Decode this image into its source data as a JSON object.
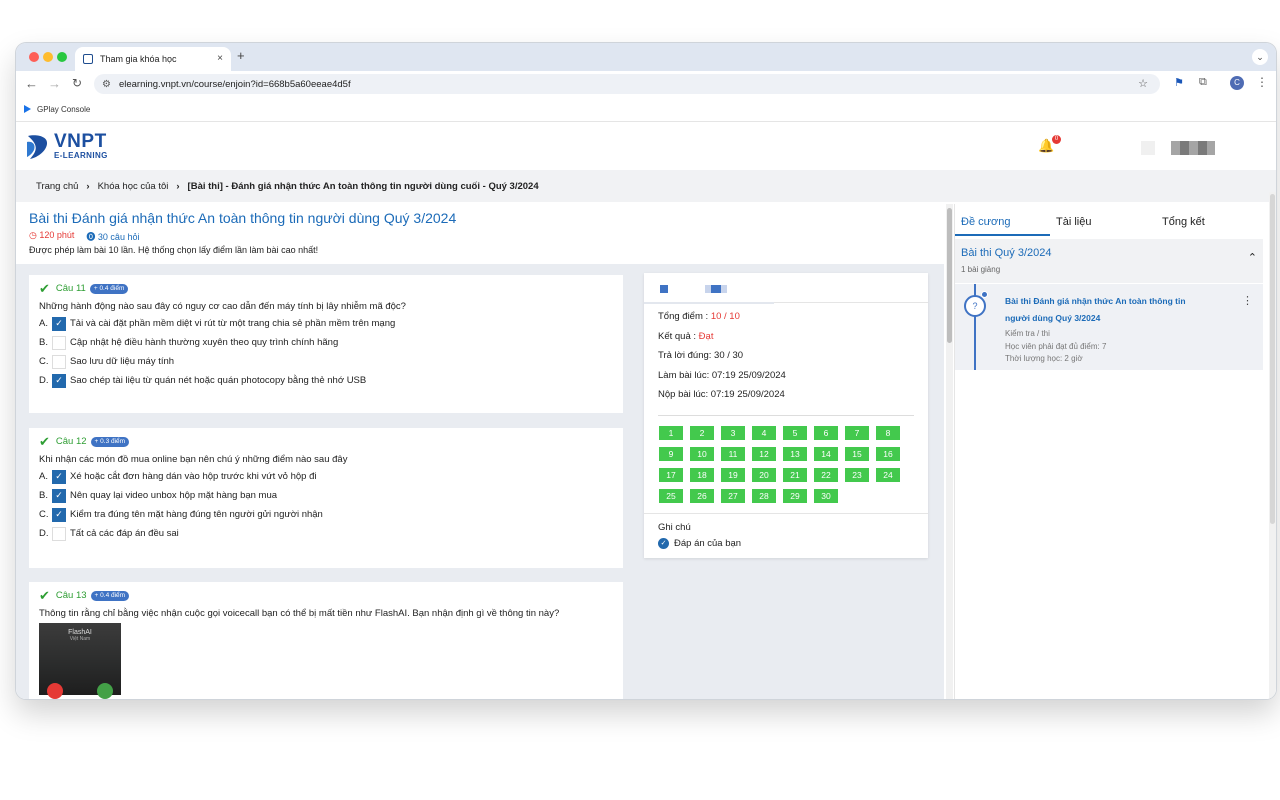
{
  "browser": {
    "tab_title": "Tham gia khóa học",
    "close_icon": "×",
    "new_tab_icon": "+",
    "url": "elearning.vnpt.vn/course/enjoin?id=668b5a60eeae4d5f",
    "bookmark": "GPlay Console",
    "avatar_letter": "C"
  },
  "site": {
    "logo_title": "VNPT",
    "logo_sub": "E-LEARNING",
    "notification_count": "0"
  },
  "breadcrumb": {
    "items": [
      "Trang chủ",
      "Khóa học của tôi",
      "[Bài thi] - Đánh giá nhận thức An toàn thông tin người dùng cuối - Quý 3/2024"
    ]
  },
  "exam": {
    "title": "Bài thi Đánh giá nhận thức An toàn thông tin người dùng Quý 3/2024",
    "duration": "120 phút",
    "question_count": "30 câu hỏi",
    "attempt_note": "Được phép làm bài 10 lần. Hệ thống chọn lấy điểm lần làm bài cao nhất!"
  },
  "questions": [
    {
      "label": "Câu 11",
      "points": "+ 0.4 điểm",
      "text": "Những hành động nào sau đây có nguy cơ cao dẫn đến máy tính bị lây nhiễm mã độc?",
      "options": [
        {
          "letter": "A.",
          "text": "Tải và cài đặt phần mềm diệt vi rút từ một trang chia sẻ phần mềm trên mạng",
          "checked": true
        },
        {
          "letter": "B.",
          "text": "Cập nhật hệ điều hành thường xuyên theo quy trình chính hãng",
          "checked": false
        },
        {
          "letter": "C.",
          "text": "Sao lưu dữ liệu máy tính",
          "checked": false
        },
        {
          "letter": "D.",
          "text": "Sao chép tài liệu từ quán nét hoặc quán photocopy bằng thẻ nhớ USB",
          "checked": true
        }
      ]
    },
    {
      "label": "Câu 12",
      "points": "+ 0.3 điểm",
      "text": "Khi nhận các món đồ mua online bạn nên chú ý những điểm nào sau đây",
      "options": [
        {
          "letter": "A.",
          "text": "Xé hoặc cắt đơn hàng dán vào hộp trước khi vứt vỏ hộp đi",
          "checked": true
        },
        {
          "letter": "B.",
          "text": "Nên quay lại video unbox hộp mặt hàng bạn mua",
          "checked": true
        },
        {
          "letter": "C.",
          "text": "Kiểm tra đúng tên mặt hàng đúng tên người gửi người nhận",
          "checked": true
        },
        {
          "letter": "D.",
          "text": "Tất cả các đáp án đều sai",
          "checked": false
        }
      ]
    },
    {
      "label": "Câu 13",
      "points": "+ 0.4 điểm",
      "text": "Thông tin rằng chỉ bằng việc nhận cuộc gọi voicecall bạn có thể bị mất tiền như FlashAI. Bạn nhận định gì về thông tin này?",
      "image_caption": "FlashAI",
      "image_sub": "Việt Nam"
    }
  ],
  "result": {
    "total_label": "Tổng điểm : ",
    "total_value": "10 / 10",
    "result_label": "Kết quả : ",
    "result_value": "Đạt",
    "correct": "Trả lời đúng: 30 / 30",
    "start": "Làm bài lúc: 07:19 25/09/2024",
    "submit": "Nộp bài lúc: 07:19 25/09/2024",
    "numbers": [
      "1",
      "2",
      "3",
      "4",
      "5",
      "6",
      "7",
      "8",
      "9",
      "10",
      "11",
      "12",
      "13",
      "14",
      "15",
      "16",
      "17",
      "18",
      "19",
      "20",
      "21",
      "22",
      "23",
      "24",
      "25",
      "26",
      "27",
      "28",
      "29",
      "30"
    ],
    "note_title": "Ghi chú",
    "note_item": "Đáp án của bạn"
  },
  "sidebar": {
    "tabs": [
      "Đề cương",
      "Tài liệu",
      "Tổng kết"
    ],
    "section_title": "Bài thi Quý 3/2024",
    "section_count": "1 bài giảng",
    "lesson_title": "Bài thi Đánh giá nhận thức An toàn thông tin người dùng Quý 3/2024",
    "lesson_type": "Kiểm tra / thi",
    "lesson_req": "Học viên phải đạt đủ điểm: 7",
    "lesson_time": "Thời lượng học: 2 giờ"
  }
}
